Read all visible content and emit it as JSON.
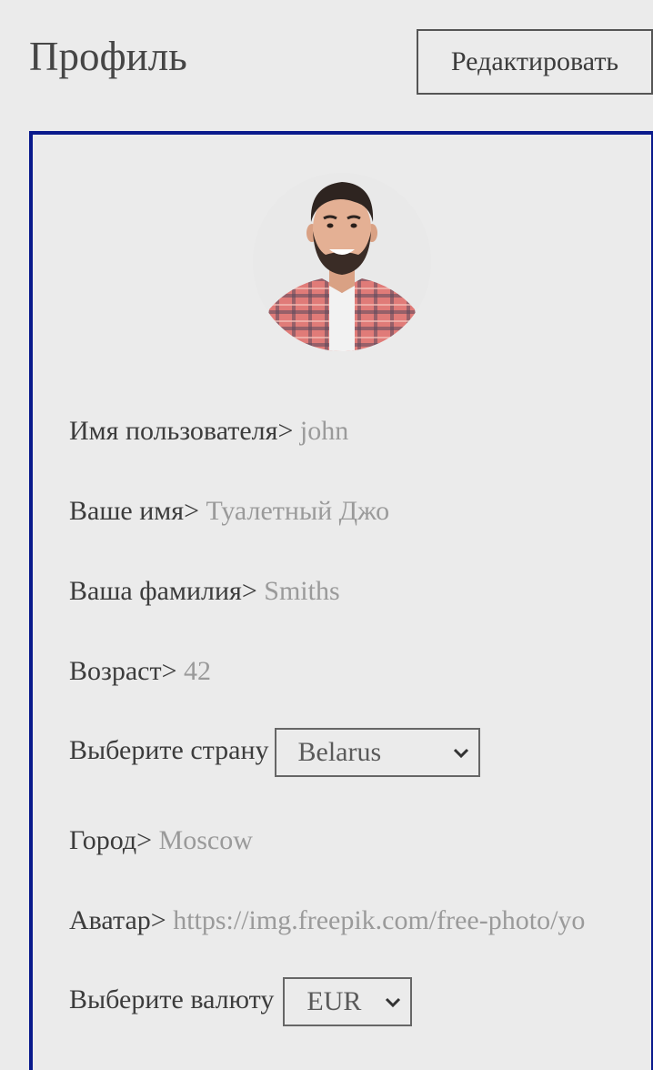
{
  "header": {
    "title": "Профиль",
    "edit_label": "Редактировать"
  },
  "profile": {
    "avatar_icon": "user-photo",
    "fields": [
      {
        "label": "Имя пользователя>",
        "value": "john"
      },
      {
        "label": "Ваше имя>",
        "value": "Туалетный Джо"
      },
      {
        "label": "Ваша фамилия>",
        "value": "Smiths"
      },
      {
        "label": "Возраст>",
        "value": "42"
      },
      {
        "label": "Город>",
        "value": "Moscow"
      },
      {
        "label": "Аватар>",
        "value": "https://img.freepik.com/free-photo/yo"
      }
    ],
    "country": {
      "label": "Выберите страну",
      "selected": "Belarus"
    },
    "currency": {
      "label": "Выберите валюту",
      "selected": "EUR"
    }
  },
  "colors": {
    "card_border": "#0a1a8c",
    "background": "#ebebeb",
    "value_text": "#9a9a9a"
  }
}
